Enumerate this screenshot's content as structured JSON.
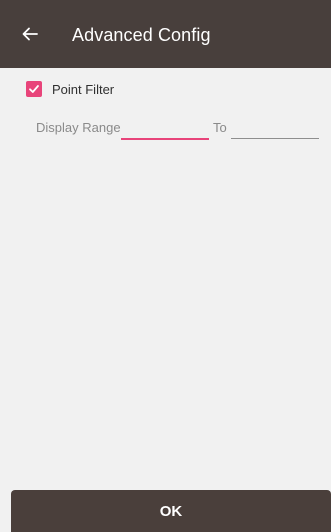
{
  "app_bar": {
    "back_icon": "arrow-left-icon",
    "title": "Advanced Config",
    "background": "#483f3c"
  },
  "point_filter": {
    "label": "Point Filter",
    "checked": true,
    "accent": "#e8447a"
  },
  "display_range": {
    "label": "Display Range",
    "from_value": "",
    "to_label": "To",
    "to_value": ""
  },
  "ok_button": {
    "label": "OK"
  }
}
